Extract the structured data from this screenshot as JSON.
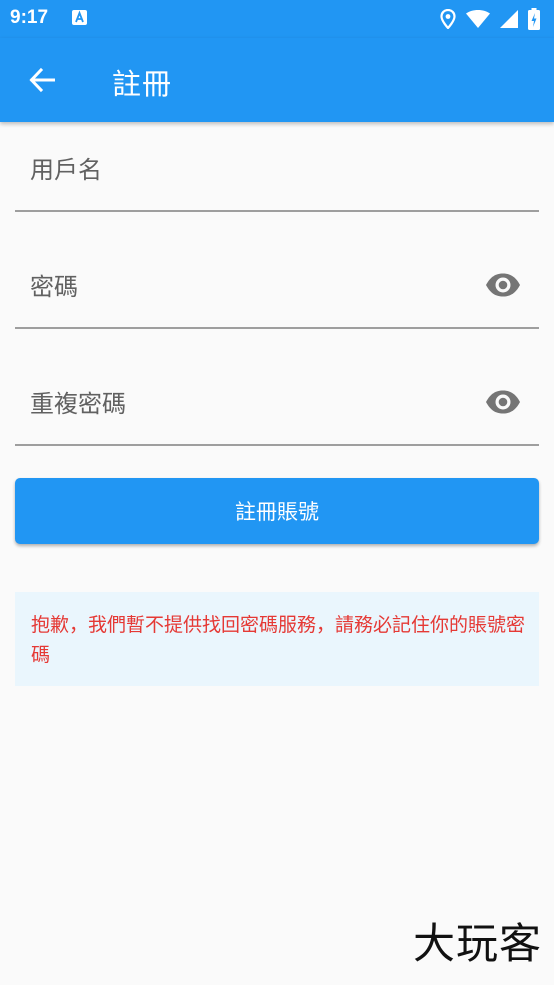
{
  "status_bar": {
    "time": "9:17",
    "icons": [
      "notification-a-icon",
      "location-icon",
      "wifi-icon",
      "signal-icon",
      "battery-icon"
    ]
  },
  "app_bar": {
    "title": "註冊",
    "back_icon": "arrow-back-icon",
    "color": "#2196f3"
  },
  "form": {
    "username_label": "用戶名",
    "password_label": "密碼",
    "confirm_password_label": "重複密碼",
    "visibility_icon": "eye-icon"
  },
  "submit_button": {
    "label": "註冊賬號"
  },
  "notice": {
    "text": "抱歉，我們暫不提供找回密碼服務，請務必記住你的賬號密碼",
    "text_color": "#e53935",
    "background": "#eaf6fd"
  },
  "watermark": "大玩客"
}
